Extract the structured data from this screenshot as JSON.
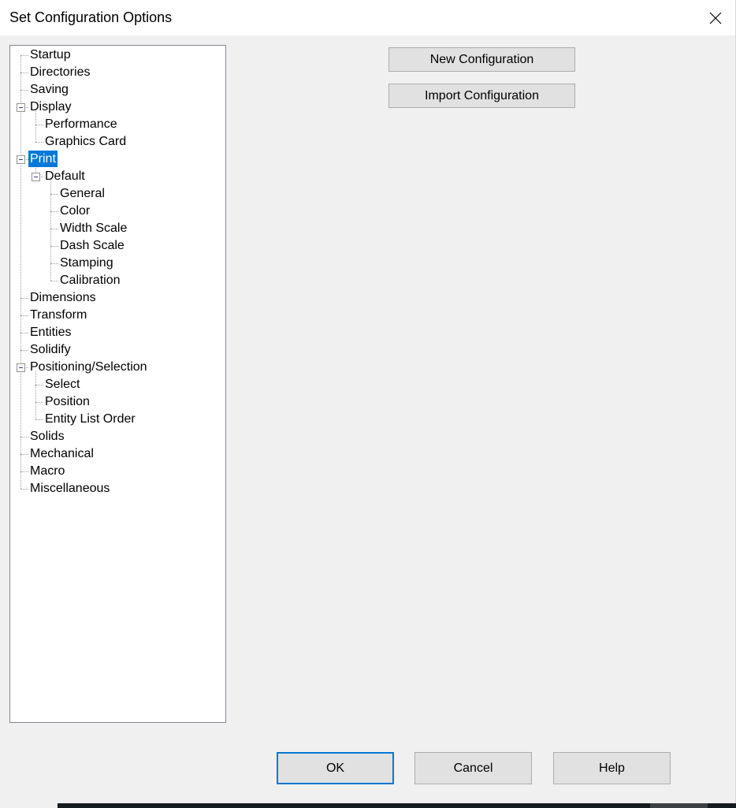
{
  "window": {
    "title": "Set Configuration Options",
    "close_icon": "close-icon"
  },
  "tree": {
    "selected": "Print",
    "items": [
      {
        "label": "Startup",
        "level": 0
      },
      {
        "label": "Directories",
        "level": 0
      },
      {
        "label": "Saving",
        "level": 0
      },
      {
        "label": "Display",
        "level": 0,
        "expanded": true
      },
      {
        "label": "Performance",
        "level": 1
      },
      {
        "label": "Graphics Card",
        "level": 1
      },
      {
        "label": "Print",
        "level": 0,
        "expanded": true,
        "selected": true
      },
      {
        "label": "Default",
        "level": 1,
        "expanded": true
      },
      {
        "label": "General",
        "level": 2
      },
      {
        "label": "Color",
        "level": 2
      },
      {
        "label": "Width Scale",
        "level": 2
      },
      {
        "label": "Dash Scale",
        "level": 2
      },
      {
        "label": "Stamping",
        "level": 2
      },
      {
        "label": "Calibration",
        "level": 2
      },
      {
        "label": "Dimensions",
        "level": 0
      },
      {
        "label": "Transform",
        "level": 0
      },
      {
        "label": "Entities",
        "level": 0
      },
      {
        "label": "Solidify",
        "level": 0
      },
      {
        "label": "Positioning/Selection",
        "level": 0,
        "expanded": true
      },
      {
        "label": "Select",
        "level": 1
      },
      {
        "label": "Position",
        "level": 1
      },
      {
        "label": "Entity List Order",
        "level": 1
      },
      {
        "label": "Solids",
        "level": 0
      },
      {
        "label": "Mechanical",
        "level": 0
      },
      {
        "label": "Macro",
        "level": 0
      },
      {
        "label": "Miscellaneous",
        "level": 0
      }
    ]
  },
  "actions": {
    "new_configuration": "New Configuration",
    "import_configuration": "Import Configuration"
  },
  "footer": {
    "ok": "OK",
    "cancel": "Cancel",
    "help": "Help"
  },
  "colors": {
    "selection": "#0078d7",
    "default_button_border": "#0078d7"
  }
}
